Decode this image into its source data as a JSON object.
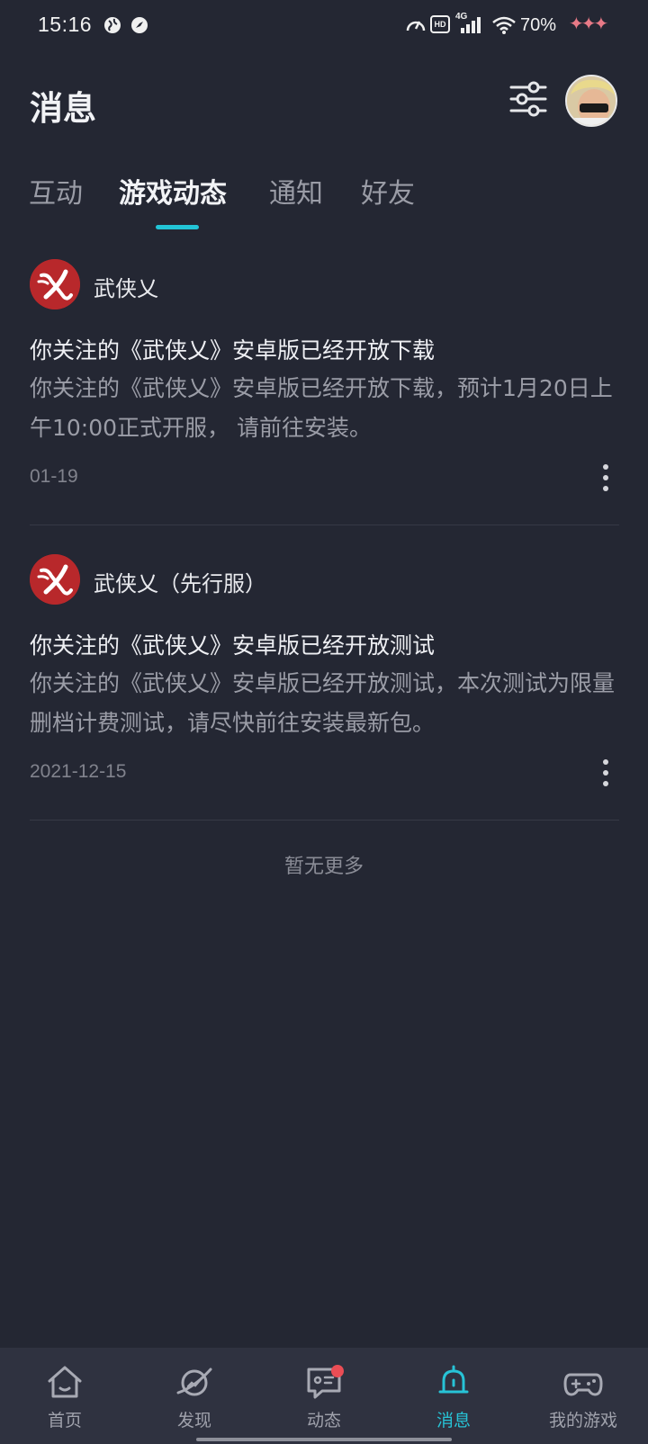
{
  "status_bar": {
    "time": "15:16",
    "battery": "70%",
    "network": "4G",
    "hd_badge": "HD",
    "sparkle": "✦✦✦"
  },
  "header": {
    "title": "消息",
    "filter_icon": "sliders-icon",
    "avatar_icon": "user-avatar"
  },
  "tabs": [
    {
      "label": "互动",
      "active": false
    },
    {
      "label": "游戏动态",
      "active": true
    },
    {
      "label": "通知",
      "active": false
    },
    {
      "label": "好友",
      "active": false
    }
  ],
  "accent_color": "#22c4d6",
  "feed": [
    {
      "game_name": "武侠乂",
      "title": "你关注的《武侠乂》安卓版已经开放下载",
      "body": "你关注的《武侠乂》安卓版已经开放下载，预计1月20日上午10:00正式开服， 请前往安装。",
      "date": "01-19"
    },
    {
      "game_name": "武侠乂（先行服）",
      "title": "你关注的《武侠乂》安卓版已经开放测试",
      "body": "你关注的《武侠乂》安卓版已经开放测试，本次测试为限量删档计费测试，请尽快前往安装最新包。",
      "date": "2021-12-15"
    }
  ],
  "footer_text": "暂无更多",
  "bottom_nav": [
    {
      "label": "首页",
      "icon": "home-icon",
      "active": false
    },
    {
      "label": "发现",
      "icon": "planet-icon",
      "active": false
    },
    {
      "label": "动态",
      "icon": "chat-icon",
      "active": false,
      "badge": true
    },
    {
      "label": "消息",
      "icon": "bell-icon",
      "active": true
    },
    {
      "label": "我的游戏",
      "icon": "gamepad-icon",
      "active": false
    }
  ]
}
